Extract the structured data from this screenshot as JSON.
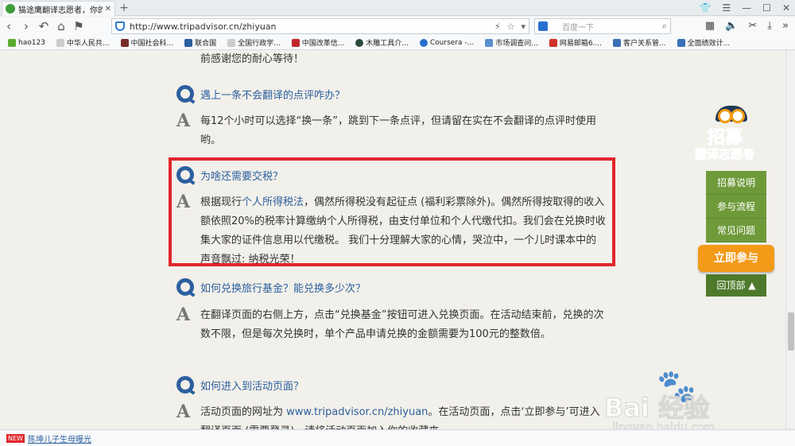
{
  "browser": {
    "tab_title": "猫途鹰翻译志愿者，你的...",
    "tab_close": "✕",
    "new_tab": "+",
    "url": "http://www.tripadvisor.cn/zhiyuan",
    "search_placeholder": "百度一下",
    "bookmarks": [
      "hao123",
      "中华人民共...",
      "中国社会科...",
      "联合国",
      "全国行政学...",
      "中国改革信...",
      "木雕工具介...",
      "Coursera -...",
      "市场调查问...",
      "网易邮箱6....",
      "客户关系管...",
      "全面绩效计..."
    ]
  },
  "page": {
    "top_line": "前感谢您的耐心等待！",
    "faq": [
      {
        "q": "遇上一条不会翻译的点评咋办？",
        "a": "每12个小时可以选择“换一条”，跳到下一条点评，但请留在实在不会翻译的点评时使用哟。"
      },
      {
        "q": "为啥还需要交税？",
        "a_pre": "根据现行",
        "a_link": "个人所得税法",
        "a_post": "，偶然所得税没有起征点 (福利彩票除外)。偶然所得按取得的收入额依照20%的税率计算缴纳个人所得税，由支付单位和个人代缴代扣。我们会在兑换时收集大家的证件信息用以代缴税。 我们十分理解大家的心情，哭泣中，一个儿时课本中的声音飘过: 纳税光荣！"
      },
      {
        "q": "如何兑换旅行基金？能兑换多少次？",
        "a": "在翻译页面的右侧上方，点击“兑换基金”按钮可进入兑换页面。在活动结束前，兑换的次数不限，但是每次兑换时，单个产品申请兑换的金额需要为100元的整数倍。"
      },
      {
        "q": "如何进入到活动页面？",
        "a_pre": "活动页面的网址为 ",
        "a_link": "www.tripadvisor.cn/zhiyuan",
        "a_post": "。在活动页面，点击‘立即参与’可进入翻译页面 (需要登录)，请将活动页面加入你的收藏夹。"
      }
    ]
  },
  "widget": {
    "title1": "招募",
    "title2": "翻译志愿者",
    "items": [
      "招募说明",
      "参与流程",
      "常见问题"
    ],
    "join": "立即参与",
    "back_top": "回顶部 ▲"
  },
  "watermark": {
    "text": "Bai  经验",
    "url": "jingyan.baidu.com"
  },
  "status": {
    "badge": "NEW",
    "news": "陈坤儿子生母曝光"
  }
}
